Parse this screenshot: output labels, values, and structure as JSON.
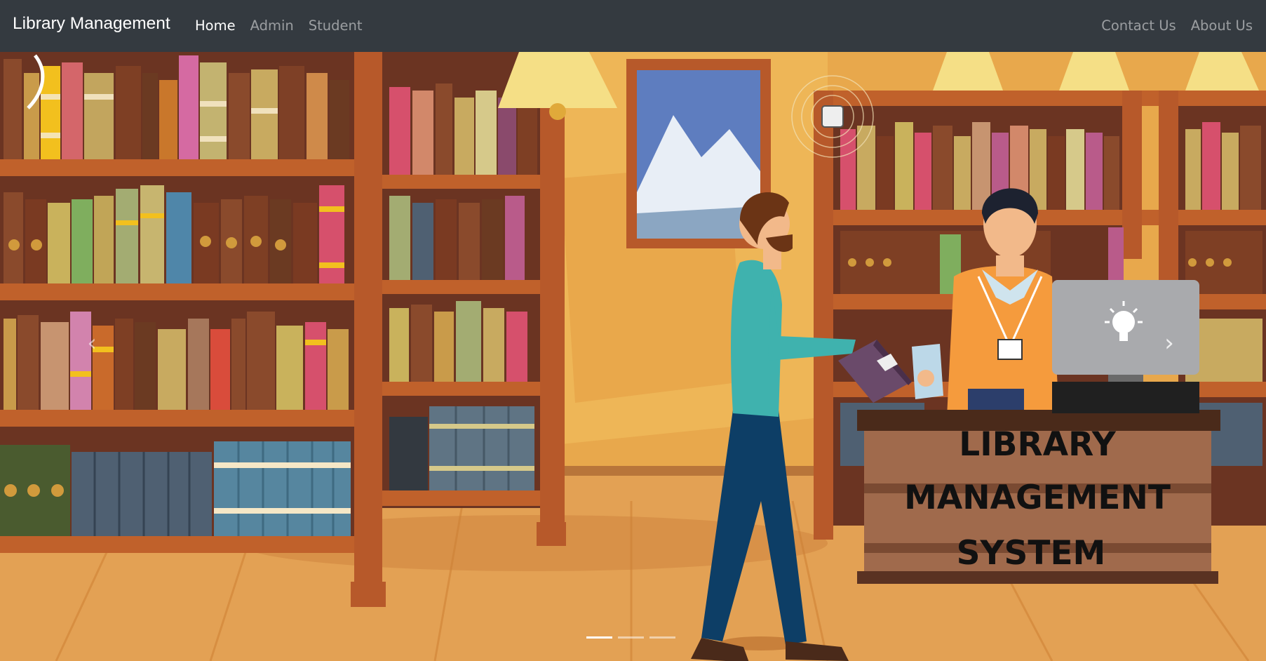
{
  "navbar": {
    "brand": "Library Management",
    "left_links": [
      "Home",
      "Admin",
      "Student"
    ],
    "right_links": [
      "Contact Us",
      "About Us"
    ],
    "active_link": "Home"
  },
  "carousel": {
    "prev_icon": "chevron-left-icon",
    "next_icon": "chevron-right-icon",
    "prev_glyph": "‹",
    "next_glyph": "›",
    "slide_count": 3,
    "active_slide": 1,
    "sign_lines": [
      "LIBRARY",
      "MANAGEMENT",
      "SYSTEM"
    ]
  },
  "colors": {
    "navbar_bg": "#343a40",
    "nav_active": "#ffffff",
    "nav_inactive": "#9a9da0",
    "wall": "#e8a84c",
    "shelf_wood": "#b9582a"
  }
}
